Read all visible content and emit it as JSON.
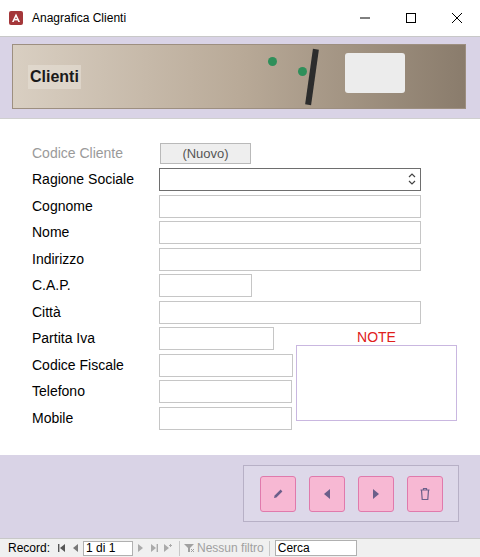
{
  "window": {
    "title": "Anagrafica Clienti"
  },
  "header": {
    "title": "Clienti"
  },
  "fields": [
    {
      "label": "Codice Cliente",
      "value": "(Nuovo)",
      "kind": "auto",
      "disabled": true
    },
    {
      "label": "Ragione Sociale",
      "value": "",
      "kind": "combo",
      "disabled": false
    },
    {
      "label": "Cognome",
      "value": "",
      "kind": "text",
      "disabled": false
    },
    {
      "label": "Nome",
      "value": "",
      "kind": "text",
      "disabled": false
    },
    {
      "label": "Indirizzo",
      "value": "",
      "kind": "text",
      "disabled": false
    },
    {
      "label": "C.A.P.",
      "value": "",
      "kind": "text",
      "disabled": false
    },
    {
      "label": "Città",
      "value": "",
      "kind": "text",
      "disabled": false
    },
    {
      "label": "Partita Iva",
      "value": "",
      "kind": "text",
      "disabled": false
    },
    {
      "label": "Codice Fiscale",
      "value": "",
      "kind": "text",
      "disabled": false
    },
    {
      "label": "Telefono",
      "value": "",
      "kind": "text",
      "disabled": false
    },
    {
      "label": "Mobile",
      "value": "",
      "kind": "text",
      "disabled": false
    }
  ],
  "notes": {
    "label": "NOTE",
    "value": ""
  },
  "nav_bar": {
    "label": "Record:",
    "position": "1 di 1",
    "filter": {
      "label": "Nessun filtro",
      "disabled": true
    },
    "search": {
      "value": "Cerca"
    }
  }
}
